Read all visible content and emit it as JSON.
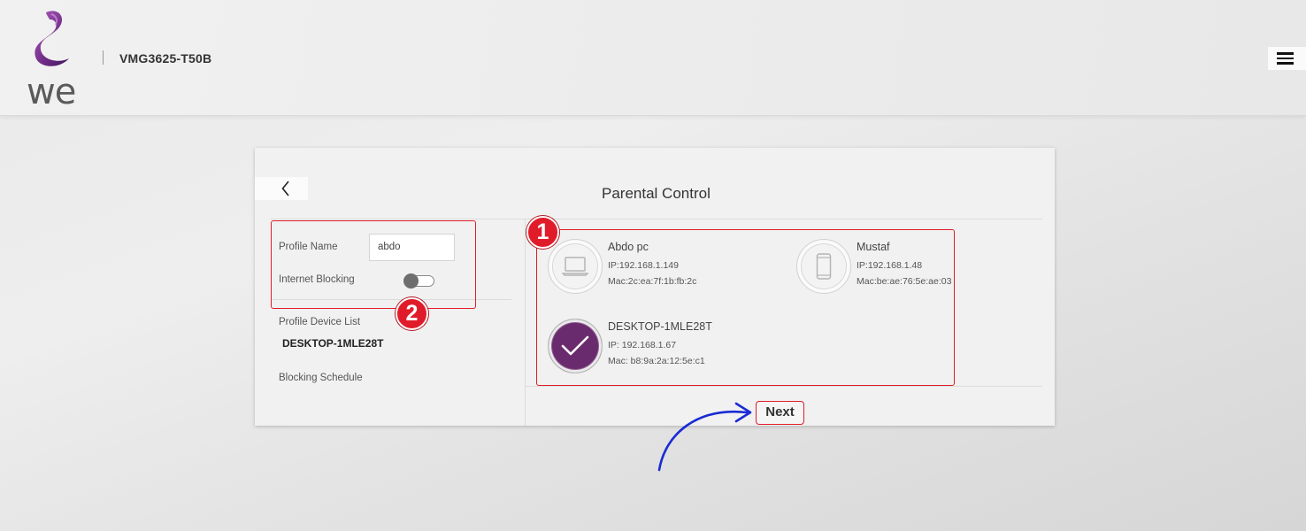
{
  "header": {
    "logo_text": "we",
    "model": "VMG3625-T50B",
    "menu_icon": "hamburger-menu-icon"
  },
  "card": {
    "back_icon": "chevron-left-icon",
    "title": "Parental Control",
    "profile_name_label": "Profile Name",
    "profile_name_value": "abdo",
    "internet_blocking_label": "Internet Blocking",
    "internet_blocking_on": false,
    "profile_device_list_label": "Profile Device List",
    "profile_device_list_value": "DESKTOP-1MLE28T",
    "blocking_schedule_label": "Blocking Schedule",
    "next_label": "Next"
  },
  "devices": [
    {
      "name": "Abdo pc",
      "ip": "IP:192.168.1.149",
      "mac": "Mac:2c:ea:7f:1b:fb:2c",
      "icon": "laptop-icon",
      "selected": false
    },
    {
      "name": "Mustaf",
      "ip": "IP:192.168.1.48",
      "mac": "Mac:be:ae:76:5e:ae:03",
      "icon": "phone-icon",
      "selected": false
    },
    {
      "name": "DESKTOP-1MLE28T",
      "ip": "IP: 192.168.1.67",
      "mac": "Mac: b8:9a:2a:12:5e:c1",
      "icon": "checkmark-icon",
      "selected": true
    }
  ],
  "annotations": {
    "badge_1": "1",
    "badge_2": "2",
    "colors": {
      "annotation_red": "#e11c2a",
      "arrow_blue": "#1a2bd4",
      "selected_purple": "#6a2a6e"
    }
  }
}
